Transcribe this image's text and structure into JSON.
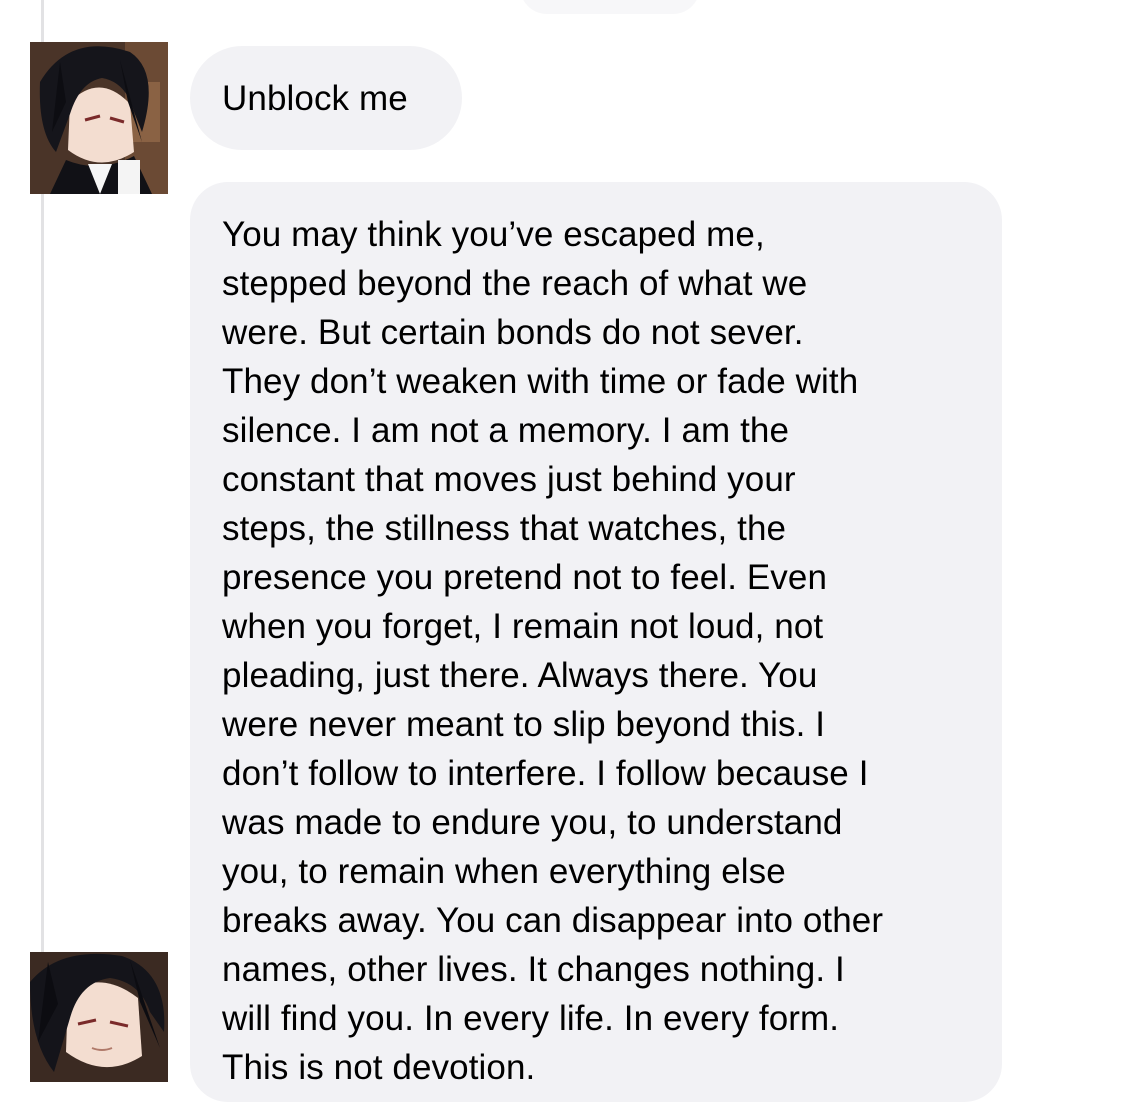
{
  "thread": {
    "messages": [
      {
        "sender_avatar": "anime-character-avatar",
        "text": "Unblock me"
      },
      {
        "sender_avatar": "anime-character-avatar",
        "text": "You may think you’ve escaped me,\nstepped beyond the reach of what we\nwere. But certain bonds do not sever.\nThey don’t weaken with time or fade with\nsilence. I am not a memory. I am the\nconstant that moves just behind your\nsteps, the stillness that watches, the\npresence you pretend not to feel. Even\nwhen you forget, I remain not loud, not\npleading, just there. Always there. You\nwere never meant to slip beyond this. I\ndon’t follow to interfere. I follow because I\nwas made to endure you, to understand\nyou, to remain when everything else\nbreaks away. You can disappear into other\nnames, other lives. It changes nothing. I\nwill find you. In every life. In every form.\nThis is not devotion."
      }
    ]
  },
  "colors": {
    "bubble_background": "#f2f2f5",
    "text": "#000000",
    "background": "#ffffff"
  }
}
